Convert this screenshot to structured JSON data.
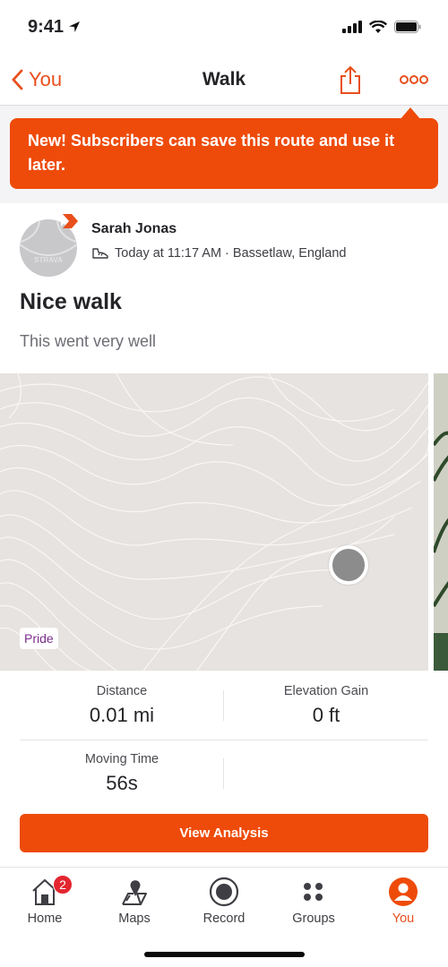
{
  "status_bar": {
    "time": "9:41"
  },
  "nav": {
    "back_label": "You",
    "title": "Walk"
  },
  "banner": {
    "text": "New! Subscribers can save this route and use it later."
  },
  "activity": {
    "athlete_name": "Sarah Jonas",
    "meta": "Today at 11:17 AM · Bassetlaw, England",
    "title": "Nice walk",
    "description": "This went very well",
    "map_tag": "Pride"
  },
  "stats": [
    {
      "label": "Distance",
      "value": "0.01 mi"
    },
    {
      "label": "Elevation Gain",
      "value": "0 ft"
    },
    {
      "label": "Moving Time",
      "value": "56s"
    }
  ],
  "actions": {
    "view_analysis": "View Analysis"
  },
  "tabbar": {
    "items": [
      {
        "label": "Home",
        "badge": "2"
      },
      {
        "label": "Maps"
      },
      {
        "label": "Record"
      },
      {
        "label": "Groups"
      },
      {
        "label": "You"
      }
    ]
  },
  "colors": {
    "accent": "#ee4b0a",
    "badge": "#e3262f"
  }
}
